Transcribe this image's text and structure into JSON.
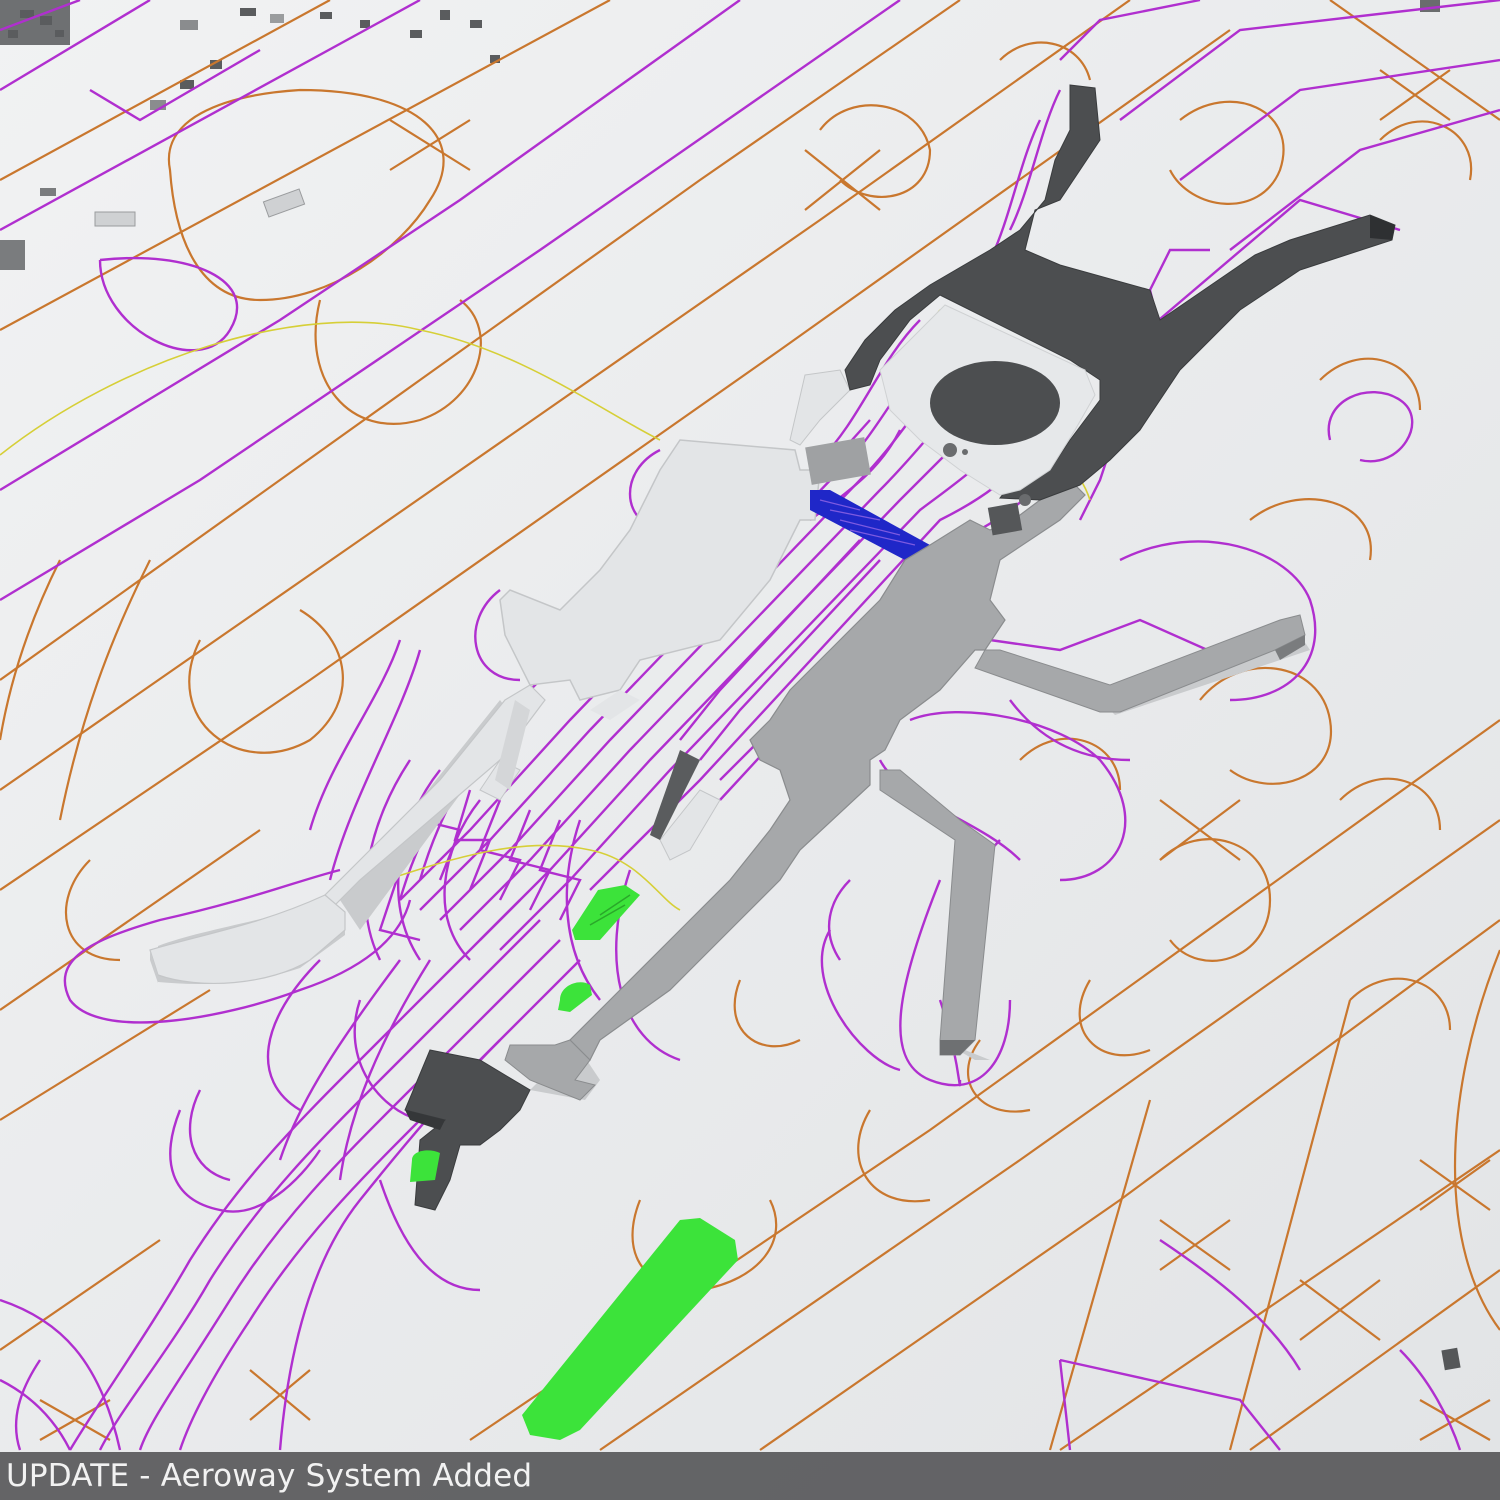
{
  "caption": {
    "text": "UPDATE - Aeroway System Added"
  },
  "colors": {
    "ground": "#e9ebed",
    "taxiway_edge": "#c9772e",
    "service_road": "#b02fcf",
    "rail_line": "#d6cf37",
    "terminal_light": "#e3e5e7",
    "terminal_mid": "#a6a8aa",
    "terminal_dark": "#4c4e50",
    "green_area": "#3ce33a",
    "blue_area": "#1f27c8",
    "caption_bar": "#58585a",
    "caption_text": "#f2f2f2"
  }
}
